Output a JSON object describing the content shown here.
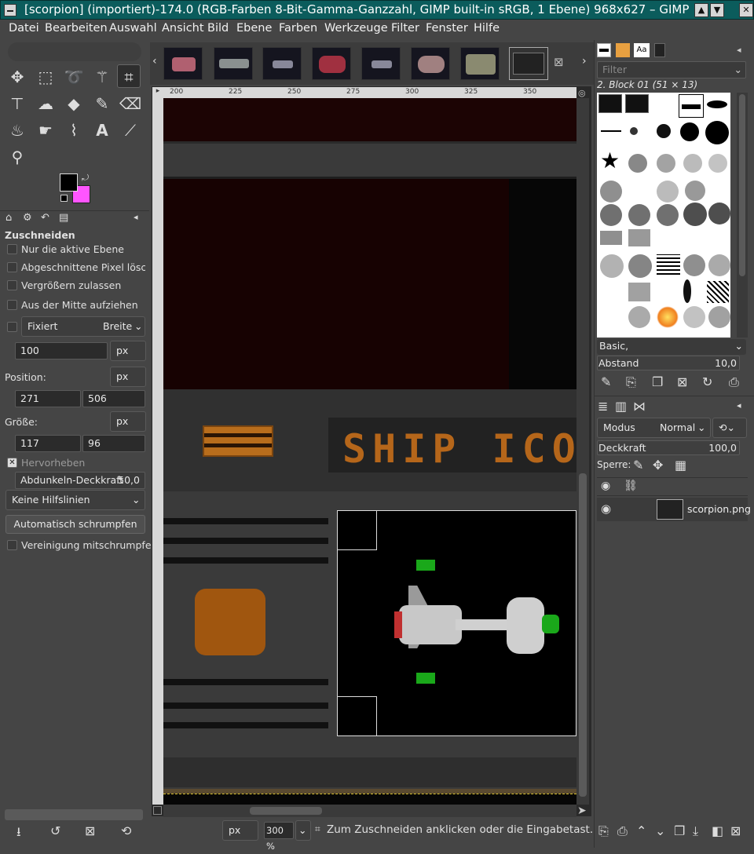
{
  "window": {
    "title": "[scorpion] (importiert)-174.0 (RGB-Farben 8-Bit-Gamma-Ganzzahl, GIMP built-in sRGB, 1 Ebene) 968x627 – GIMP",
    "controls": [
      "▲",
      "▼",
      "✕"
    ]
  },
  "menu": [
    "Datei",
    "Bearbeiten",
    "Auswahl",
    "Ansicht",
    "Bild",
    "Ebene",
    "Farben",
    "Werkzeuge",
    "Filter",
    "Fenster",
    "Hilfe"
  ],
  "toolbox": {
    "tools": [
      "move-icon",
      "rect-select-icon",
      "lasso-icon",
      "fuzzy-select-icon",
      "crop-icon",
      "unified-transform-icon",
      "warp-icon",
      "bucket-fill-icon",
      "paintbrush-icon",
      "eraser-icon",
      "clone-icon",
      "smudge-icon",
      "paths-icon",
      "text-icon",
      "color-picker-icon",
      "zoom-icon"
    ],
    "fg_color": "#000000",
    "bg_color": "#ff55ff"
  },
  "tool_options": {
    "title": "Zuschneiden",
    "only_active_layer": "Nur die aktive Ebene",
    "delete_cropped": "Abgeschnittene Pixel löschen",
    "allow_growing": "Vergrößern zulassen",
    "expand_center": "Aus der Mitte aufziehen",
    "fixed_label": "Fixiert",
    "fixed_mode": "Breite",
    "fixed_value": "100",
    "unit": "px",
    "position_label": "Position:",
    "position_x": "271",
    "position_y": "506",
    "size_label": "Größe:",
    "size_w": "117",
    "size_h": "96",
    "highlight_label": "Hervorheben",
    "darken_label": "Abdunkeln-Deckkraft",
    "darken_value": "50,0",
    "guides": "Keine Hilfslinien",
    "auto_shrink": "Automatisch schrumpfen",
    "shrink_merged": "Vereinigung mitschrumpfen"
  },
  "ruler": {
    "ticks": [
      "200",
      "225",
      "250",
      "275",
      "300",
      "325",
      "350"
    ]
  },
  "canvas": {
    "banner_text": "SHIP ICO"
  },
  "status": {
    "unit": "px",
    "zoom": "300 %",
    "message": "Zum Zuschneiden anklicken oder die Eingabetast…"
  },
  "brushes": {
    "filter_placeholder": "Filter",
    "selected": "2. Block 01 (51 × 13)",
    "preset": "Basic,",
    "spacing_label": "Abstand",
    "spacing_value": "10,0"
  },
  "layers": {
    "mode_label": "Modus",
    "mode_value": "Normal",
    "opacity_label": "Deckkraft",
    "opacity_value": "100,0",
    "lock_label": "Sperre:",
    "layer_name": "scorpion.png"
  }
}
